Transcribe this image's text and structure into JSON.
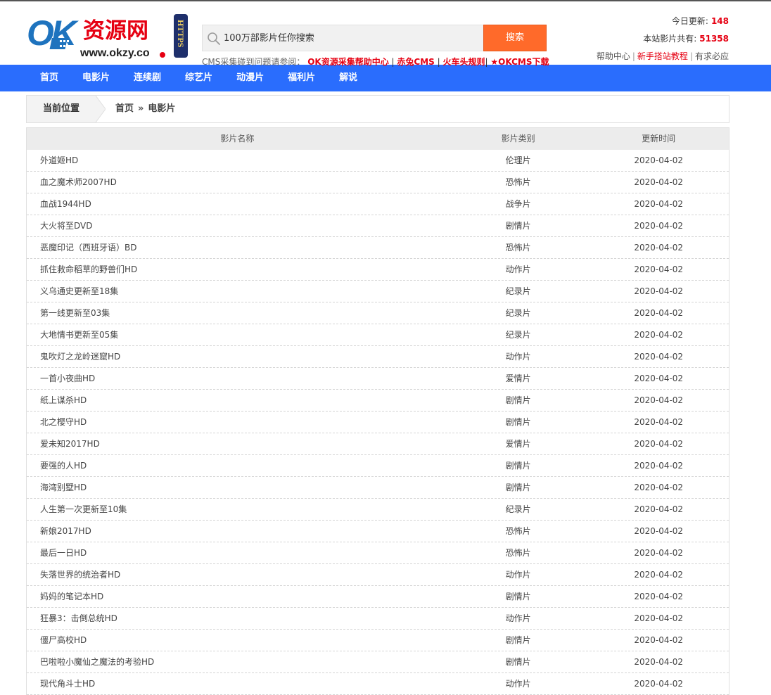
{
  "logo": {
    "ok": "OK",
    "brand": "资源网",
    "domain": "www.okzy.co",
    "badge": "HTTPS"
  },
  "search": {
    "placeholder": "100万部影片任你搜索",
    "button": "搜索"
  },
  "cms_line": {
    "prefix": "CMS采集碰到问题请参阅：",
    "links": [
      "OK资源采集帮助中心",
      "赤兔CMS",
      "火车头规则",
      "★OKCMS下载"
    ]
  },
  "stats": {
    "today_label": "今日更新:",
    "today_value": "148",
    "total_label": "本站影片共有:",
    "total_value": "51358",
    "links": [
      "帮助中心",
      "新手搭站教程",
      "有求必应"
    ]
  },
  "nav": [
    "首页",
    "电影片",
    "连续剧",
    "综艺片",
    "动漫片",
    "福利片",
    "解说"
  ],
  "breadcrumb": {
    "label": "当前位置",
    "home": "首页",
    "sep": "»",
    "current": "电影片"
  },
  "table": {
    "headers": [
      "影片名称",
      "影片类别",
      "更新时间"
    ],
    "rows": [
      [
        "外道姬HD",
        "伦理片",
        "2020-04-02"
      ],
      [
        "血之魔术师2007HD",
        "恐怖片",
        "2020-04-02"
      ],
      [
        "血战1944HD",
        "战争片",
        "2020-04-02"
      ],
      [
        "大火将至DVD",
        "剧情片",
        "2020-04-02"
      ],
      [
        "恶魔印记（西班牙语）BD",
        "恐怖片",
        "2020-04-02"
      ],
      [
        "抓住救命稻草的野兽们HD",
        "动作片",
        "2020-04-02"
      ],
      [
        "义乌通史更新至18集",
        "纪录片",
        "2020-04-02"
      ],
      [
        "第一线更新至03集",
        "纪录片",
        "2020-04-02"
      ],
      [
        "大地情书更新至05集",
        "纪录片",
        "2020-04-02"
      ],
      [
        "鬼吹灯之龙岭迷窟HD",
        "动作片",
        "2020-04-02"
      ],
      [
        "一首小夜曲HD",
        "爱情片",
        "2020-04-02"
      ],
      [
        "纸上谋杀HD",
        "剧情片",
        "2020-04-02"
      ],
      [
        "北之樱守HD",
        "剧情片",
        "2020-04-02"
      ],
      [
        "爱未知2017HD",
        "爱情片",
        "2020-04-02"
      ],
      [
        "要强的人HD",
        "剧情片",
        "2020-04-02"
      ],
      [
        "海湾别墅HD",
        "剧情片",
        "2020-04-02"
      ],
      [
        "人生第一次更新至10集",
        "纪录片",
        "2020-04-02"
      ],
      [
        "新娘2017HD",
        "恐怖片",
        "2020-04-02"
      ],
      [
        "最后一日HD",
        "恐怖片",
        "2020-04-02"
      ],
      [
        "失落世界的统治者HD",
        "动作片",
        "2020-04-02"
      ],
      [
        "妈妈的笔记本HD",
        "剧情片",
        "2020-04-02"
      ],
      [
        "狂暴3：击倒总统HD",
        "动作片",
        "2020-04-02"
      ],
      [
        "僵尸高校HD",
        "剧情片",
        "2020-04-02"
      ],
      [
        "巴啦啦小魔仙之魔法的考验HD",
        "剧情片",
        "2020-04-02"
      ],
      [
        "现代角斗士HD",
        "动作片",
        "2020-04-02"
      ]
    ]
  },
  "colors": {
    "nav_bg": "#2a6dfd",
    "search_button": "#ff6a2a",
    "accent_red": "#e60012",
    "logo_blue": "#1e73be"
  }
}
